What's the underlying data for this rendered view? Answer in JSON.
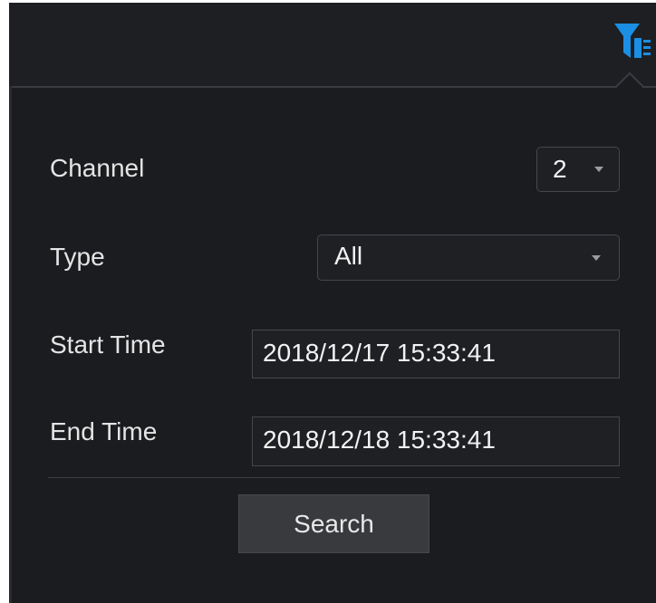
{
  "toolbar": {
    "filter_icon": "filter-list-icon"
  },
  "filter_panel": {
    "channel": {
      "label": "Channel",
      "value": "2"
    },
    "type": {
      "label": "Type",
      "value": "All"
    },
    "start_time": {
      "label": "Start Time",
      "value": "2018/12/17 15:33:41"
    },
    "end_time": {
      "label": "End Time",
      "value": "2018/12/18 15:33:41"
    },
    "search_label": "Search"
  },
  "colors": {
    "accent": "#1a8fe3",
    "background": "#1b1c1f",
    "field_background": "#1e2024"
  }
}
